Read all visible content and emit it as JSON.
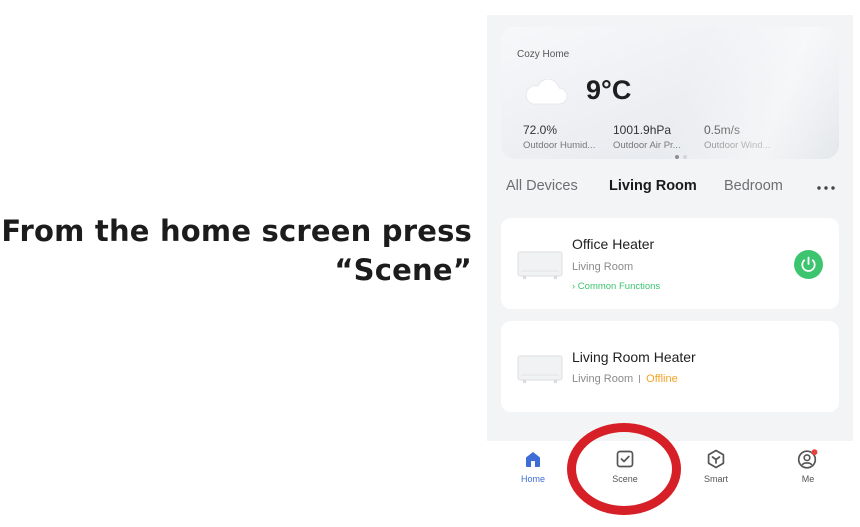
{
  "instruction": {
    "line1": "From the home screen press",
    "line2": "“Scene”"
  },
  "weather": {
    "home_name": "Cozy Home",
    "temperature": "9°C",
    "icon": "cloud-icon",
    "stats": [
      {
        "value": "72.0%",
        "label": "Outdoor Humid..."
      },
      {
        "value": "1001.9hPa",
        "label": "Outdoor Air Pr..."
      },
      {
        "value": "0.5m/s",
        "label": "Outdoor Wind..."
      }
    ]
  },
  "tabs": [
    {
      "label": "All Devices",
      "active": false
    },
    {
      "label": "Living Room",
      "active": true
    },
    {
      "label": "Bedroom",
      "active": false
    }
  ],
  "devices": [
    {
      "name": "Office Heater",
      "room": "Living Room",
      "function_link": "› Common Functions",
      "power": "on"
    },
    {
      "name": "Living Room Heater",
      "room": "Living Room",
      "status": "Offline"
    }
  ],
  "bottom_nav": [
    {
      "label": "Home",
      "icon": "home-icon",
      "active": true
    },
    {
      "label": "Scene",
      "icon": "scene-icon",
      "active": false
    },
    {
      "label": "Smart",
      "icon": "smart-icon",
      "active": false
    },
    {
      "label": "Me",
      "icon": "profile-icon",
      "active": false,
      "badge": true
    }
  ],
  "colors": {
    "accent_blue": "#3e6dd8",
    "power_green": "#3cc46f",
    "offline_orange": "#f2a323",
    "highlight_red": "#d61f26"
  }
}
